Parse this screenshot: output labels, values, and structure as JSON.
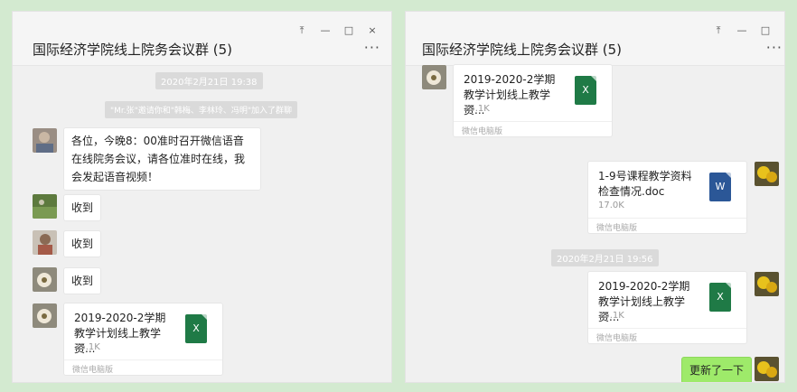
{
  "colors": {
    "accent_green": "#9eea6a",
    "excel": "#1f7a46",
    "word": "#2b5797"
  },
  "window_controls": {
    "pin": "⤒",
    "minimize": "—",
    "maximize": "□",
    "close": "×"
  },
  "left": {
    "title": "国际经济学院线上院务会议群 (5)",
    "more": "···",
    "timestamp": "2020年2月21日 19:38",
    "system_msg": "\"Mr.张\"邀请你和\"韩梅、李林玲、冯明\"加入了群聊",
    "messages": [
      {
        "text": "各位，今晚8：00准时召开微信语音在线院务会议，请各位准时在线，我会发起语音视频！"
      },
      {
        "text": "收到"
      },
      {
        "text": "收到"
      },
      {
        "text": "收到"
      }
    ],
    "file": {
      "name": "2019-2020-2学期教学计划线上教学资...",
      "size": "25.1K",
      "source": "微信电脑版",
      "icon": "X"
    }
  },
  "right": {
    "title": "国际经济学院线上院务会议群 (5)",
    "more": "···",
    "file1": {
      "name": "2019-2020-2学期教学计划线上教学资...",
      "size": "25.1K",
      "source": "微信电脑版",
      "icon": "X"
    },
    "file2": {
      "name": "1-9号课程教学资料检查情况.doc",
      "size": "17.0K",
      "source": "微信电脑版",
      "icon": "W"
    },
    "timestamp": "2020年2月21日 19:56",
    "file3": {
      "name": "2019-2020-2学期教学计划线上教学资...",
      "size": "25.1K",
      "source": "微信电脑版",
      "icon": "X"
    },
    "reply": "更新了一下"
  }
}
